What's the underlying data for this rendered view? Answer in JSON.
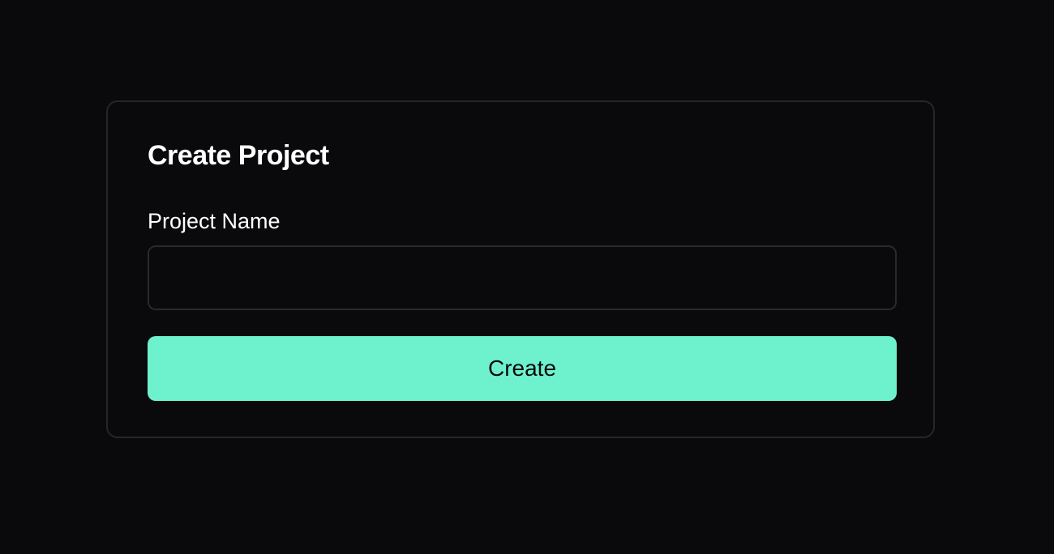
{
  "form": {
    "title": "Create Project",
    "project_name_label": "Project Name",
    "project_name_value": "",
    "project_name_placeholder": "",
    "submit_label": "Create"
  },
  "colors": {
    "background": "#0a0a0c",
    "card_border": "#26262a",
    "accent": "#6ef2cd",
    "text": "#ffffff"
  }
}
